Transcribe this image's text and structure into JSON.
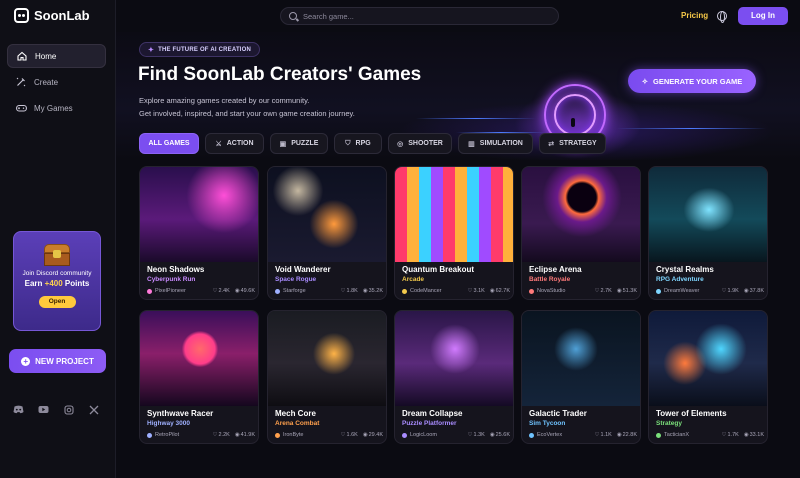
{
  "app": {
    "name": "SoonLab"
  },
  "sidebar": {
    "items": [
      {
        "label": "Home",
        "icon": "home-icon"
      },
      {
        "label": "Create",
        "icon": "create-icon"
      },
      {
        "label": "My Games",
        "icon": "gamepad-icon"
      }
    ],
    "promo": {
      "line1": "Join Discord community",
      "line2_prefix": "Earn ",
      "line2_highlight": "+400",
      "line2_suffix": " Points",
      "button": "Open"
    },
    "new_project": "NEW PROJECT",
    "socials": [
      "discord-icon",
      "youtube-icon",
      "instagram-icon",
      "x-icon"
    ]
  },
  "topbar": {
    "search_placeholder": "Search game...",
    "pricing": "Pricing",
    "login": "Log In"
  },
  "hero": {
    "badge": "THE FUTURE OF AI CREATION",
    "title": "Find SoonLab Creators' Games",
    "subtitle_line1": "Explore amazing games created by our community.",
    "subtitle_line2": "Get involved, inspired, and start your own game creation journey.",
    "generate_button": "GENERATE YOUR GAME"
  },
  "filters": [
    {
      "label": "ALL GAMES",
      "icon": ""
    },
    {
      "label": "ACTION",
      "icon": "sword-icon"
    },
    {
      "label": "PUZZLE",
      "icon": "puzzle-icon"
    },
    {
      "label": "RPG",
      "icon": "shield-icon"
    },
    {
      "label": "SHOOTER",
      "icon": "crosshair-icon"
    },
    {
      "label": "SIMULATION",
      "icon": "building-icon"
    },
    {
      "label": "STRATEGY",
      "icon": "strategy-icon"
    }
  ],
  "games": [
    {
      "title": "Neon Shadows",
      "genre": "Cyberpunk Run",
      "genre_color": "#c98bff",
      "author": "PixelPioneer",
      "likes": "2.4K",
      "views": "49.6K"
    },
    {
      "title": "Void Wanderer",
      "genre": "Space Rogue",
      "genre_color": "#a98cff",
      "author": "Starforge",
      "likes": "1.8K",
      "views": "35.2K"
    },
    {
      "title": "Quantum Breakout",
      "genre": "Arcade",
      "genre_color": "#f2c94c",
      "author": "CodeMancer",
      "likes": "3.1K",
      "views": "62.7K"
    },
    {
      "title": "Eclipse Arena",
      "genre": "Battle Royale",
      "genre_color": "#ff7a7a",
      "author": "NovaStudio",
      "likes": "2.7K",
      "views": "51.3K"
    },
    {
      "title": "Crystal Realms",
      "genre": "RPG Adventure",
      "genre_color": "#7fd6ff",
      "author": "DreamWeaver",
      "likes": "1.9K",
      "views": "37.8K"
    },
    {
      "title": "Synthwave Racer",
      "genre": "Highway 3000",
      "genre_color": "#9fb0ff",
      "author": "RetroPilot",
      "likes": "2.2K",
      "views": "41.9K"
    },
    {
      "title": "Mech Core",
      "genre": "Arena Combat",
      "genre_color": "#ffa04d",
      "author": "IronByte",
      "likes": "1.6K",
      "views": "29.4K"
    },
    {
      "title": "Dream Collapse",
      "genre": "Puzzle Platformer",
      "genre_color": "#a98cff",
      "author": "LogicLoom",
      "likes": "1.3K",
      "views": "25.6K"
    },
    {
      "title": "Galactic Trader",
      "genre": "Sim Tycoon",
      "genre_color": "#6fc3ff",
      "author": "EcoVertex",
      "likes": "1.1K",
      "views": "22.8K"
    },
    {
      "title": "Tower of Elements",
      "genre": "Strategy",
      "genre_color": "#7be07b",
      "author": "TacticianX",
      "likes": "1.7K",
      "views": "33.1K"
    }
  ],
  "colors": {
    "accent": "#7b4ef0",
    "pricing": "#f7c948",
    "background": "#0b0b12"
  }
}
